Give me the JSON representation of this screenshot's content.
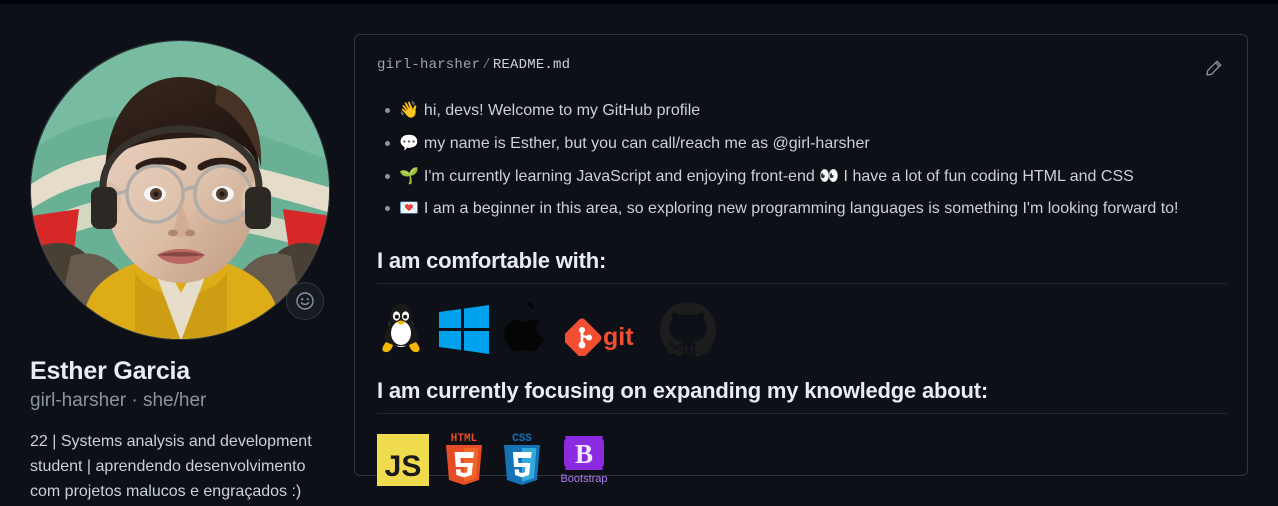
{
  "theme": {
    "page_bg": "#0d1117",
    "top_strip": "#010409",
    "card_border": "#30363d",
    "text": "#c9d1d9",
    "muted_text": "#8b949e",
    "heading": "#e6edf3",
    "rule": "#21262d"
  },
  "profile": {
    "avatar_alt": "Illustrated portrait of a person with short dark hair, round glasses, headphones and a yellow jacket on a mint-green background",
    "status_icon": "smiley-icon",
    "name": "Esther Garcia",
    "handle_line": "girl-harsher · she/her",
    "username": "girl-harsher",
    "pronouns": "she/her",
    "bio": "22 | Systems analysis and development student | aprendendo desenvolvimento com projetos malucos e engraçados :)"
  },
  "readme": {
    "breadcrumb": {
      "owner": "girl-harsher",
      "separator": "/",
      "file": "README.md"
    },
    "edit_icon": "pencil-icon",
    "bullets": [
      {
        "emoji": "👋",
        "emoji_name": "waving-hand-emoji",
        "text": "hi, devs! Welcome to my GitHub profile"
      },
      {
        "emoji": "💬",
        "emoji_name": "speech-balloon-emoji",
        "text": "my name is Esther, but you can call/reach me as @girl-harsher"
      },
      {
        "emoji": "🌱",
        "emoji_name": "seedling-emoji",
        "text": "I'm currently learning JavaScript and enjoying front-end 👀 I have a lot of fun coding HTML and CSS"
      },
      {
        "emoji": "💌",
        "emoji_name": "love-letter-emoji",
        "text": "I am a beginner in this area, so exploring new programming languages is something I'm looking forward to!"
      }
    ],
    "sections": [
      {
        "title": "I am comfortable with:",
        "badges": [
          {
            "name": "linux-badge",
            "label": "Linux"
          },
          {
            "name": "windows-badge",
            "label": "Windows"
          },
          {
            "name": "apple-badge",
            "label": "Apple"
          },
          {
            "name": "git-badge",
            "label": "git"
          },
          {
            "name": "github-badge",
            "label": "GitHub"
          }
        ]
      },
      {
        "title": "I am currently focusing on expanding my knowledge about:",
        "badges": [
          {
            "name": "javascript-badge",
            "label": "JS"
          },
          {
            "name": "html5-badge",
            "label": "HTML5"
          },
          {
            "name": "css3-badge",
            "label": "CSS3"
          },
          {
            "name": "bootstrap-badge",
            "label": "Bootstrap"
          }
        ]
      }
    ]
  }
}
